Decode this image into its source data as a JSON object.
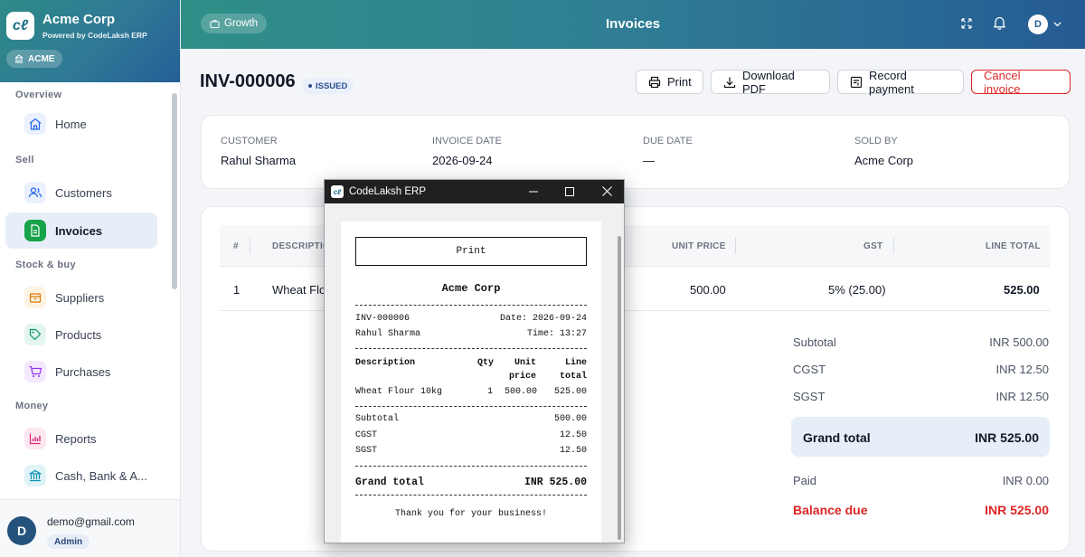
{
  "sidebar": {
    "brand": "Acme Corp",
    "powered_by": "Powered by CodeLaksh ERP",
    "org_badge": "ACME",
    "sections": [
      {
        "title": "Overview",
        "items": [
          {
            "label": "Home",
            "icon": "home-icon",
            "color": "#2563eb"
          }
        ]
      },
      {
        "title": "Sell",
        "items": [
          {
            "label": "Customers",
            "icon": "users-icon",
            "color": "#2563eb"
          },
          {
            "label": "Invoices",
            "icon": "document-icon",
            "color": "#16a34a",
            "active": true
          }
        ]
      },
      {
        "title": "Stock & buy",
        "items": [
          {
            "label": "Suppliers",
            "icon": "box-icon",
            "color": "#d97706"
          },
          {
            "label": "Products",
            "icon": "tag-icon",
            "color": "#059669"
          },
          {
            "label": "Purchases",
            "icon": "cart-icon",
            "color": "#9333ea"
          }
        ]
      },
      {
        "title": "Money",
        "items": [
          {
            "label": "Reports",
            "icon": "bar-chart-icon",
            "color": "#db2777"
          },
          {
            "label": "Cash, Bank & A...",
            "icon": "bank-icon",
            "color": "#0891b2"
          }
        ]
      }
    ],
    "user": {
      "initial": "D",
      "email": "demo@gmail.com",
      "role": "Admin"
    }
  },
  "topbar": {
    "workspace_badge": "Growth",
    "title": "Invoices",
    "avatar_initial": "D"
  },
  "invoice": {
    "number": "INV-000006",
    "status": "ISSUED",
    "actions": {
      "print": "Print",
      "download": "Download PDF",
      "record": "Record payment",
      "cancel": "Cancel invoice"
    },
    "meta": {
      "customer_label": "CUSTOMER",
      "customer": "Rahul Sharma",
      "date_label": "INVOICE DATE",
      "date": "2026-09-24",
      "due_label": "DUE DATE",
      "due": "—",
      "sold_label": "SOLD BY",
      "sold_by": "Acme Corp"
    },
    "table": {
      "headers": [
        "#",
        "DESCRIPTION",
        "UNIT PRICE",
        "GST",
        "LINE TOTAL"
      ],
      "rows": [
        {
          "num": "1",
          "description": "Wheat Flo",
          "unit_price": "500.00",
          "gst": "5% (25.00)",
          "line_total": "525.00"
        }
      ]
    },
    "totals": {
      "subtotal_label": "Subtotal",
      "subtotal": "INR 500.00",
      "cgst_label": "CGST",
      "cgst": "INR 12.50",
      "sgst_label": "SGST",
      "sgst": "INR 12.50",
      "grand_label": "Grand total",
      "grand": "INR 525.00",
      "paid_label": "Paid",
      "paid": "INR 0.00",
      "balance_label": "Balance due",
      "balance": "INR 525.00"
    }
  },
  "popup": {
    "title": "CodeLaksh ERP",
    "receipt": {
      "print_button": "Print",
      "store": "Acme Corp",
      "invoice_no": "INV-000006",
      "date": "Date: 2026-09-24",
      "customer": "Rahul Sharma",
      "time": "Time: 13:27",
      "col_desc": "Description",
      "col_qty": "Qty",
      "col_unit_1": "Unit",
      "col_unit_2": "price",
      "col_line_1": "Line",
      "col_line_2": "total",
      "item_desc": "Wheat Flour 10kg",
      "item_qty": "1",
      "item_price": "500.00",
      "item_total": "525.00",
      "subtotal_label": "Subtotal",
      "subtotal": "500.00",
      "cgst_label": "CGST",
      "cgst": "12.50",
      "sgst_label": "SGST",
      "sgst": "12.50",
      "grand_label": "Grand total",
      "grand": "INR 525.00",
      "thanks": "Thank you for your business!"
    }
  },
  "colors": {
    "accent": "#2f7d94",
    "danger": "#dc2626",
    "active_bg": "#e8eef8"
  }
}
